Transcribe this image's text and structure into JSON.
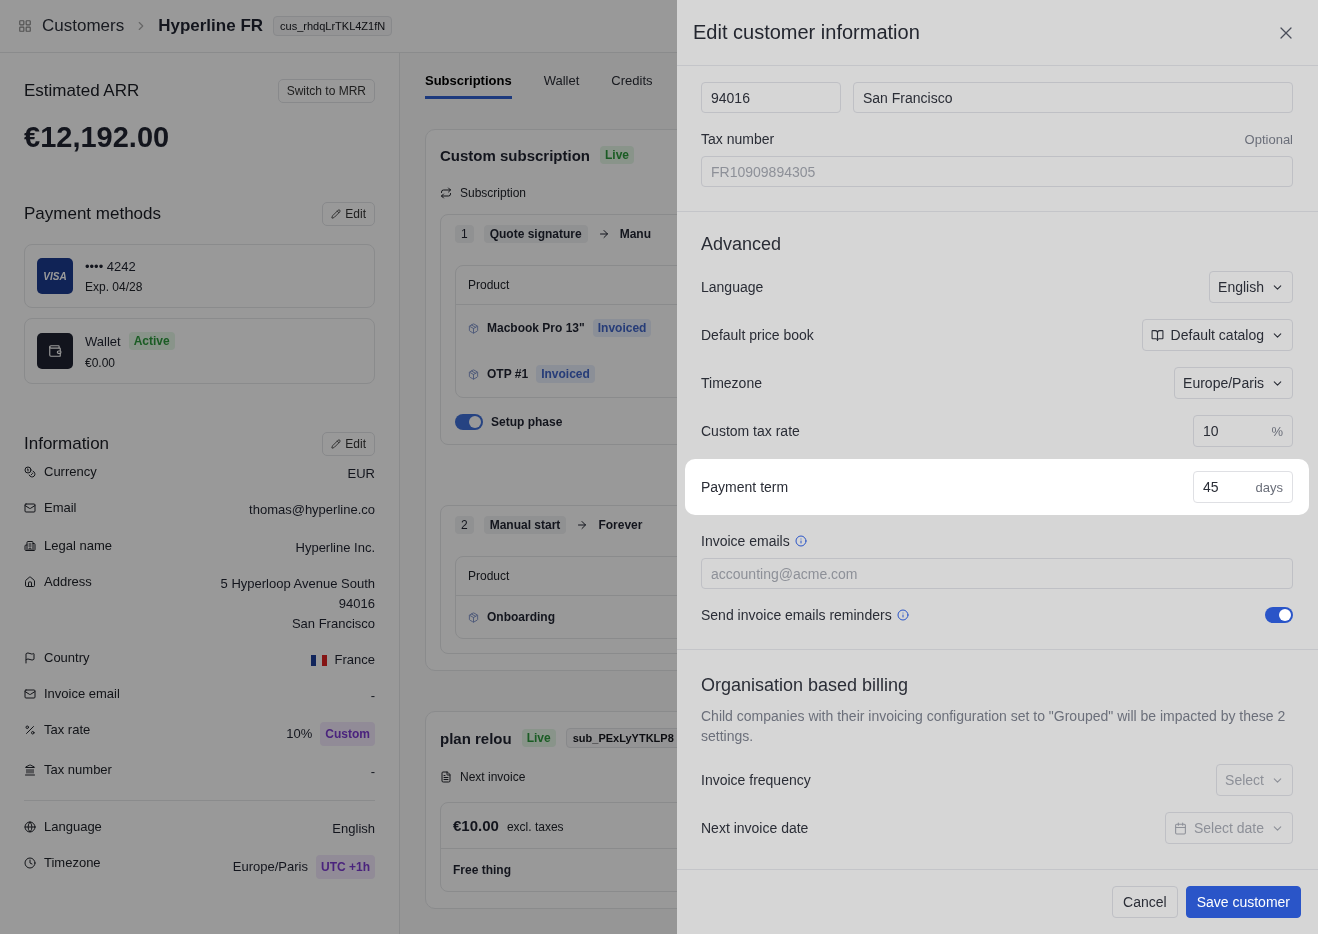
{
  "background": {
    "breadcrumb": {
      "section": "Customers",
      "current": "Hyperline FR",
      "id": "cus_rhdqLrTKL4Z1fN"
    },
    "arr": {
      "title": "Estimated ARR",
      "switch_button": "Switch to MRR",
      "amount": "€12,192.00"
    },
    "payment_methods": {
      "title": "Payment methods",
      "edit_button": "Edit",
      "items": [
        {
          "kind": "card",
          "logo_text": "VISA",
          "title": "•••• 4242",
          "subtitle": "Exp. 04/28"
        },
        {
          "kind": "wallet",
          "title": "Wallet",
          "badge": "Active",
          "subtitle": "€0.00"
        }
      ]
    },
    "information": {
      "title": "Information",
      "edit_button": "Edit",
      "groups": [
        [
          {
            "label": "Currency",
            "value": "EUR"
          },
          {
            "label": "Email",
            "value": "thomas@hyperline.co"
          }
        ],
        [
          {
            "label": "Legal name",
            "value": "Hyperline Inc."
          },
          {
            "label": "Address",
            "lines": [
              "5 Hyperloop Avenue South",
              "94016",
              "San Francisco"
            ]
          },
          {
            "label": "Country",
            "value": "France",
            "flag": true
          },
          {
            "label": "Invoice email",
            "value": "-"
          },
          {
            "label": "Tax rate",
            "value": "10%",
            "badge": "Custom"
          },
          {
            "label": "Tax number",
            "value": "-"
          }
        ],
        [
          {
            "label": "Language",
            "value": "English"
          },
          {
            "label": "Timezone",
            "value": "Europe/Paris",
            "badge": "UTC +1h"
          }
        ]
      ]
    },
    "tabs": [
      {
        "label": "Subscriptions",
        "selected": true
      },
      {
        "label": "Wallet",
        "selected": false
      },
      {
        "label": "Credits",
        "selected": false
      }
    ],
    "subscriptions": [
      {
        "name": "Custom subscription",
        "status": "Live",
        "section": "Subscription",
        "phases": [
          {
            "number": "1",
            "start": "Quote signature",
            "end": "Manu",
            "column": "Product",
            "products": [
              {
                "name": "Macbook Pro 13\"",
                "badge": "Invoiced"
              },
              {
                "name": "OTP #1",
                "badge": "Invoiced"
              }
            ],
            "setup_toggle": {
              "label": "Setup phase",
              "on": true
            }
          },
          {
            "number": "2",
            "start": "Manual start",
            "end": "Forever",
            "column": "Product",
            "products": [
              {
                "name": "Onboarding"
              }
            ]
          }
        ]
      },
      {
        "name": "plan relou",
        "status": "Live",
        "id": "sub_PExLyYTKLP8",
        "section": "Next invoice",
        "amount": "€10.00",
        "amount_note": "excl. taxes",
        "line": "Free thing"
      }
    ]
  },
  "drawer": {
    "title": "Edit customer information",
    "address": {
      "postcode": "94016",
      "city": "San Francisco"
    },
    "tax_number": {
      "label": "Tax number",
      "hint": "Optional",
      "placeholder": "FR10909894305"
    },
    "advanced": {
      "title": "Advanced",
      "rows": [
        {
          "label": "Language",
          "kind": "select",
          "value": "English",
          "highlighted": false
        },
        {
          "label": "Default price book",
          "kind": "catalog-select",
          "value": "Default catalog",
          "highlighted": false
        },
        {
          "label": "Timezone",
          "kind": "select",
          "value": "Europe/Paris",
          "highlighted": false
        },
        {
          "label": "Custom tax rate",
          "kind": "number",
          "value": "10",
          "unit": "%",
          "highlighted": false
        },
        {
          "label": "Payment term",
          "kind": "number",
          "value": "45",
          "unit": "days",
          "highlighted": true
        }
      ],
      "invoice_emails": {
        "label": "Invoice emails",
        "placeholder": "accounting@acme.com"
      },
      "reminders": {
        "label": "Send invoice emails reminders",
        "on": true
      }
    },
    "org_billing": {
      "title": "Organisation based billing",
      "description": "Child companies with their invoicing configuration set to \"Grouped\" will be impacted by these 2 settings.",
      "rows": [
        {
          "label": "Invoice frequency",
          "kind": "select",
          "placeholder": "Select"
        },
        {
          "label": "Next invoice date",
          "kind": "date",
          "placeholder": "Select date"
        }
      ]
    },
    "buttons": {
      "cancel": "Cancel",
      "save": "Save customer"
    }
  }
}
